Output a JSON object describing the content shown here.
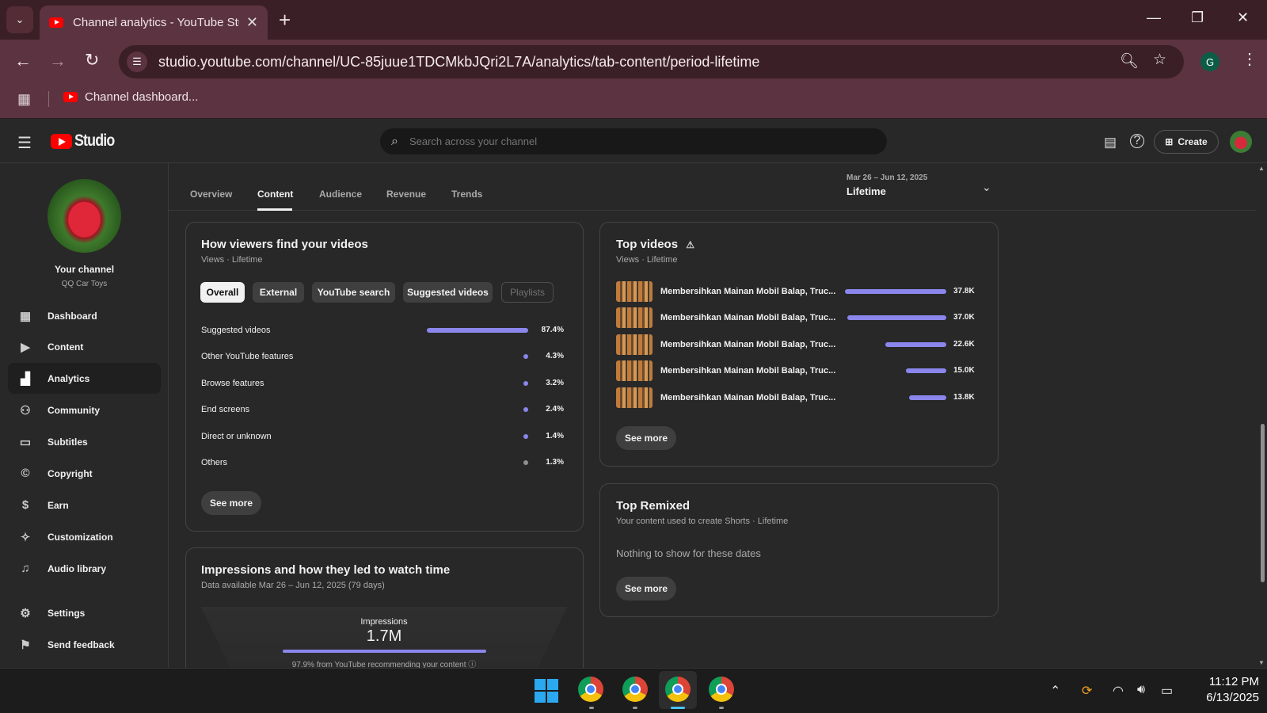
{
  "browser": {
    "tab_title": "Channel analytics - YouTube Studio",
    "url": "studio.youtube.com/channel/UC-85juue1TDCMkbJQri2L7A/analytics/tab-content/period-lifetime",
    "bookmark": "Channel dashboard...",
    "profile_letter": "G"
  },
  "studio": {
    "logo_text": "Studio",
    "search_placeholder": "Search across your channel",
    "create_label": "Create"
  },
  "channel": {
    "label": "Your channel",
    "name": "QQ Car Toys"
  },
  "sidebar": {
    "items": [
      {
        "label": "Dashboard",
        "icon": "dashboard-icon"
      },
      {
        "label": "Content",
        "icon": "content-icon"
      },
      {
        "label": "Analytics",
        "icon": "analytics-icon",
        "active": true
      },
      {
        "label": "Community",
        "icon": "community-icon"
      },
      {
        "label": "Subtitles",
        "icon": "subtitles-icon"
      },
      {
        "label": "Copyright",
        "icon": "copyright-icon"
      },
      {
        "label": "Earn",
        "icon": "dollar-icon"
      },
      {
        "label": "Customization",
        "icon": "wand-icon"
      },
      {
        "label": "Audio library",
        "icon": "audio-library-icon"
      },
      {
        "label": "Settings",
        "icon": "gear-icon"
      },
      {
        "label": "Send feedback",
        "icon": "feedback-icon"
      }
    ]
  },
  "analytics": {
    "tabs": [
      "Overview",
      "Content",
      "Audience",
      "Revenue",
      "Trends"
    ],
    "active_tab": "Content",
    "period": {
      "range": "Mar 26 – Jun 12, 2025",
      "value": "Lifetime"
    }
  },
  "traffic": {
    "title": "How viewers find your videos",
    "subtitle": "Views · Lifetime",
    "chips": [
      "Overall",
      "External",
      "YouTube search",
      "Suggested videos",
      "Playlists"
    ],
    "selected_chip": "Overall",
    "disabled_chip": "Playlists",
    "sources": [
      {
        "label": "Suggested videos",
        "pct": "87.4%",
        "share": 87.4
      },
      {
        "label": "Other YouTube features",
        "pct": "4.3%",
        "share": 4.3
      },
      {
        "label": "Browse features",
        "pct": "3.2%",
        "share": 3.2
      },
      {
        "label": "End screens",
        "pct": "2.4%",
        "share": 2.4
      },
      {
        "label": "Direct or unknown",
        "pct": "1.4%",
        "share": 1.4
      },
      {
        "label": "Others",
        "pct": "1.3%",
        "share": 1.3
      }
    ],
    "see_more": "See more"
  },
  "top_videos": {
    "title": "Top videos",
    "subtitle": "Views · Lifetime",
    "videos": [
      {
        "title": "Membersihkan Mainan Mobil Balap, Truc...",
        "views": "37.8K",
        "value": 37.8
      },
      {
        "title": "Membersihkan Mainan Mobil Balap, Truc...",
        "views": "37.0K",
        "value": 37.0
      },
      {
        "title": "Membersihkan Mainan Mobil Balap, Truc...",
        "views": "22.6K",
        "value": 22.6
      },
      {
        "title": "Membersihkan Mainan Mobil Balap, Truc...",
        "views": "15.0K",
        "value": 15.0
      },
      {
        "title": "Membersihkan Mainan Mobil Balap, Truc...",
        "views": "13.8K",
        "value": 13.8
      }
    ],
    "see_more": "See more"
  },
  "top_remixed": {
    "title": "Top Remixed",
    "subtitle": "Your content used to create Shorts · Lifetime",
    "empty": "Nothing to show for these dates",
    "see_more": "See more"
  },
  "impressions": {
    "title": "Impressions and how they led to watch time",
    "subtitle": "Data available Mar 26 – Jun 12, 2025 (79 days)",
    "label": "Impressions",
    "value": "1.7M",
    "note": "97.9% from YouTube recommending your content"
  },
  "taskbar": {
    "time": "11:12 PM",
    "date": "6/13/2025"
  },
  "colors": {
    "accent_bar": "#8a86ec",
    "youtube_red": "#ff0000",
    "browser_frame": "#5c3340"
  }
}
